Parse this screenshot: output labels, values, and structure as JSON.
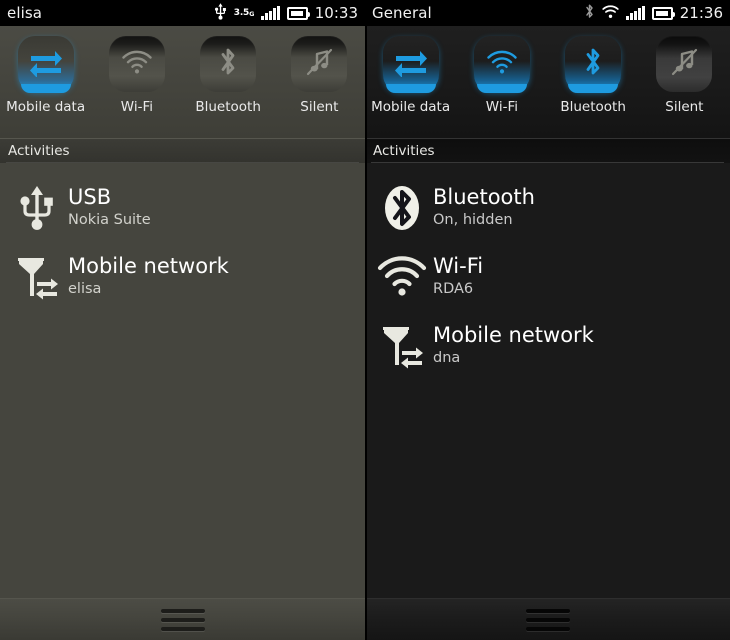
{
  "panels": [
    {
      "id": "left",
      "status": {
        "title": "elisa",
        "usb_icon": "usb-icon",
        "network_label": "3.5",
        "network_suffix": "G",
        "signal_icon": "signal-bars-icon",
        "battery_icon": "battery-icon",
        "clock": "10:33"
      },
      "toggles": [
        {
          "label": "Mobile data",
          "icon": "mobile-data-icon",
          "state": "on"
        },
        {
          "label": "Wi-Fi",
          "icon": "wifi-icon",
          "state": "off"
        },
        {
          "label": "Bluetooth",
          "icon": "bluetooth-icon",
          "state": "off"
        },
        {
          "label": "Silent",
          "icon": "silent-icon",
          "state": "off"
        }
      ],
      "activities_header": "Activities",
      "activities": [
        {
          "icon": "usb-icon",
          "title": "USB",
          "subtitle": "Nokia Suite"
        },
        {
          "icon": "mobile-network-icon",
          "title": "Mobile network",
          "subtitle": "elisa"
        }
      ]
    },
    {
      "id": "right",
      "status": {
        "title": "General",
        "bluetooth_icon": "bluetooth-icon",
        "wifi_icon": "wifi-icon",
        "signal_icon": "signal-bars-icon",
        "battery_icon": "battery-icon",
        "clock": "21:36"
      },
      "toggles": [
        {
          "label": "Mobile data",
          "icon": "mobile-data-icon",
          "state": "on"
        },
        {
          "label": "Wi-Fi",
          "icon": "wifi-icon",
          "state": "on"
        },
        {
          "label": "Bluetooth",
          "icon": "bluetooth-icon",
          "state": "on"
        },
        {
          "label": "Silent",
          "icon": "silent-icon",
          "state": "off"
        }
      ],
      "activities_header": "Activities",
      "activities": [
        {
          "icon": "bluetooth-badge-icon",
          "title": "Bluetooth",
          "subtitle": "On, hidden"
        },
        {
          "icon": "wifi-icon",
          "title": "Wi-Fi",
          "subtitle": "RDA6"
        },
        {
          "icon": "mobile-network-icon",
          "title": "Mobile network",
          "subtitle": "dna"
        }
      ]
    }
  ],
  "colors": {
    "accent_blue": "#1E9BE0",
    "left_bg": "#45453E",
    "right_bg": "#1A1A1A",
    "statusbar_bg": "#000000",
    "glyph_off": "#8d8d85",
    "text": "#ffffff"
  }
}
